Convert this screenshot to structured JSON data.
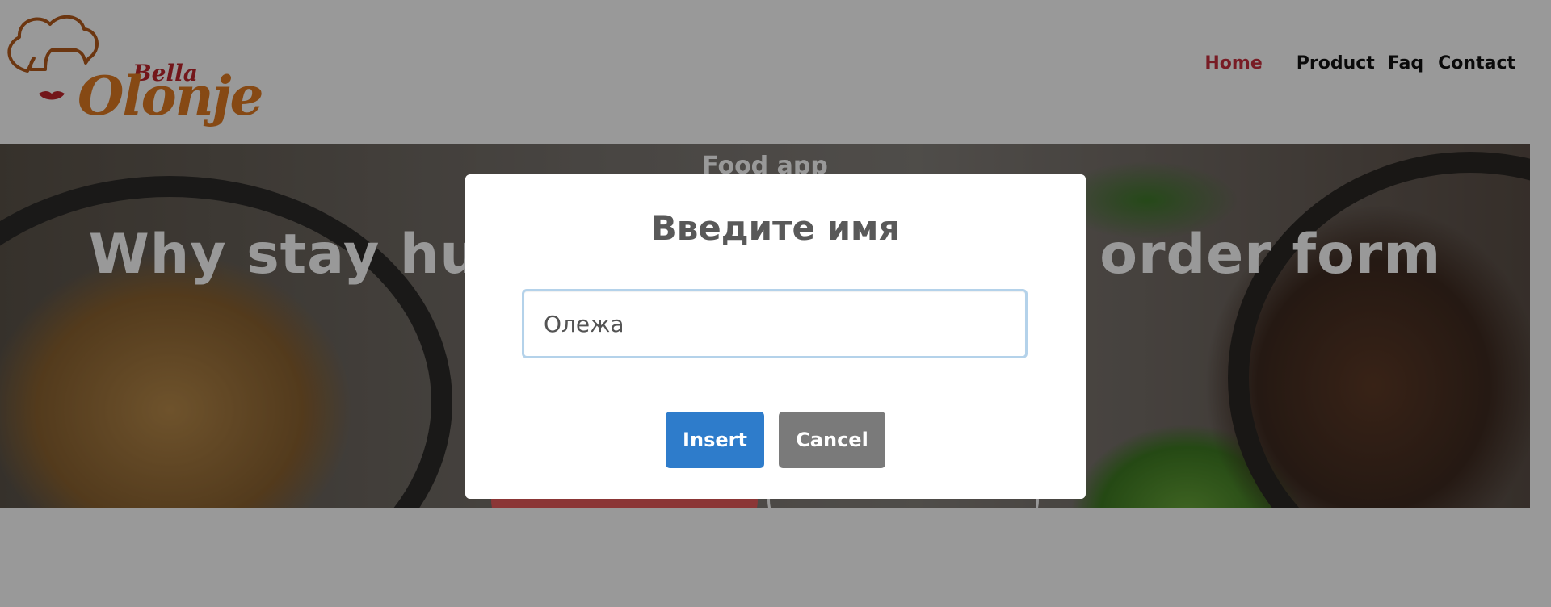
{
  "logo": {
    "line1": "Bella",
    "line2": "Olonje"
  },
  "nav": {
    "home": "Home",
    "product": "Product",
    "faq": "Faq",
    "contact": "Contact"
  },
  "hero": {
    "eyebrow": "Food app",
    "title": "Why stay hungry when you can order form Bella Onojie"
  },
  "modal": {
    "title": "Введите имя",
    "input_value": "Олежа",
    "insert_label": "Insert",
    "cancel_label": "Cancel"
  },
  "colors": {
    "nav_active": "#c9303e",
    "insert_button": "#2e7ccb",
    "cancel_button": "#7a7a7a",
    "input_focus_border": "#b4d2ea"
  }
}
